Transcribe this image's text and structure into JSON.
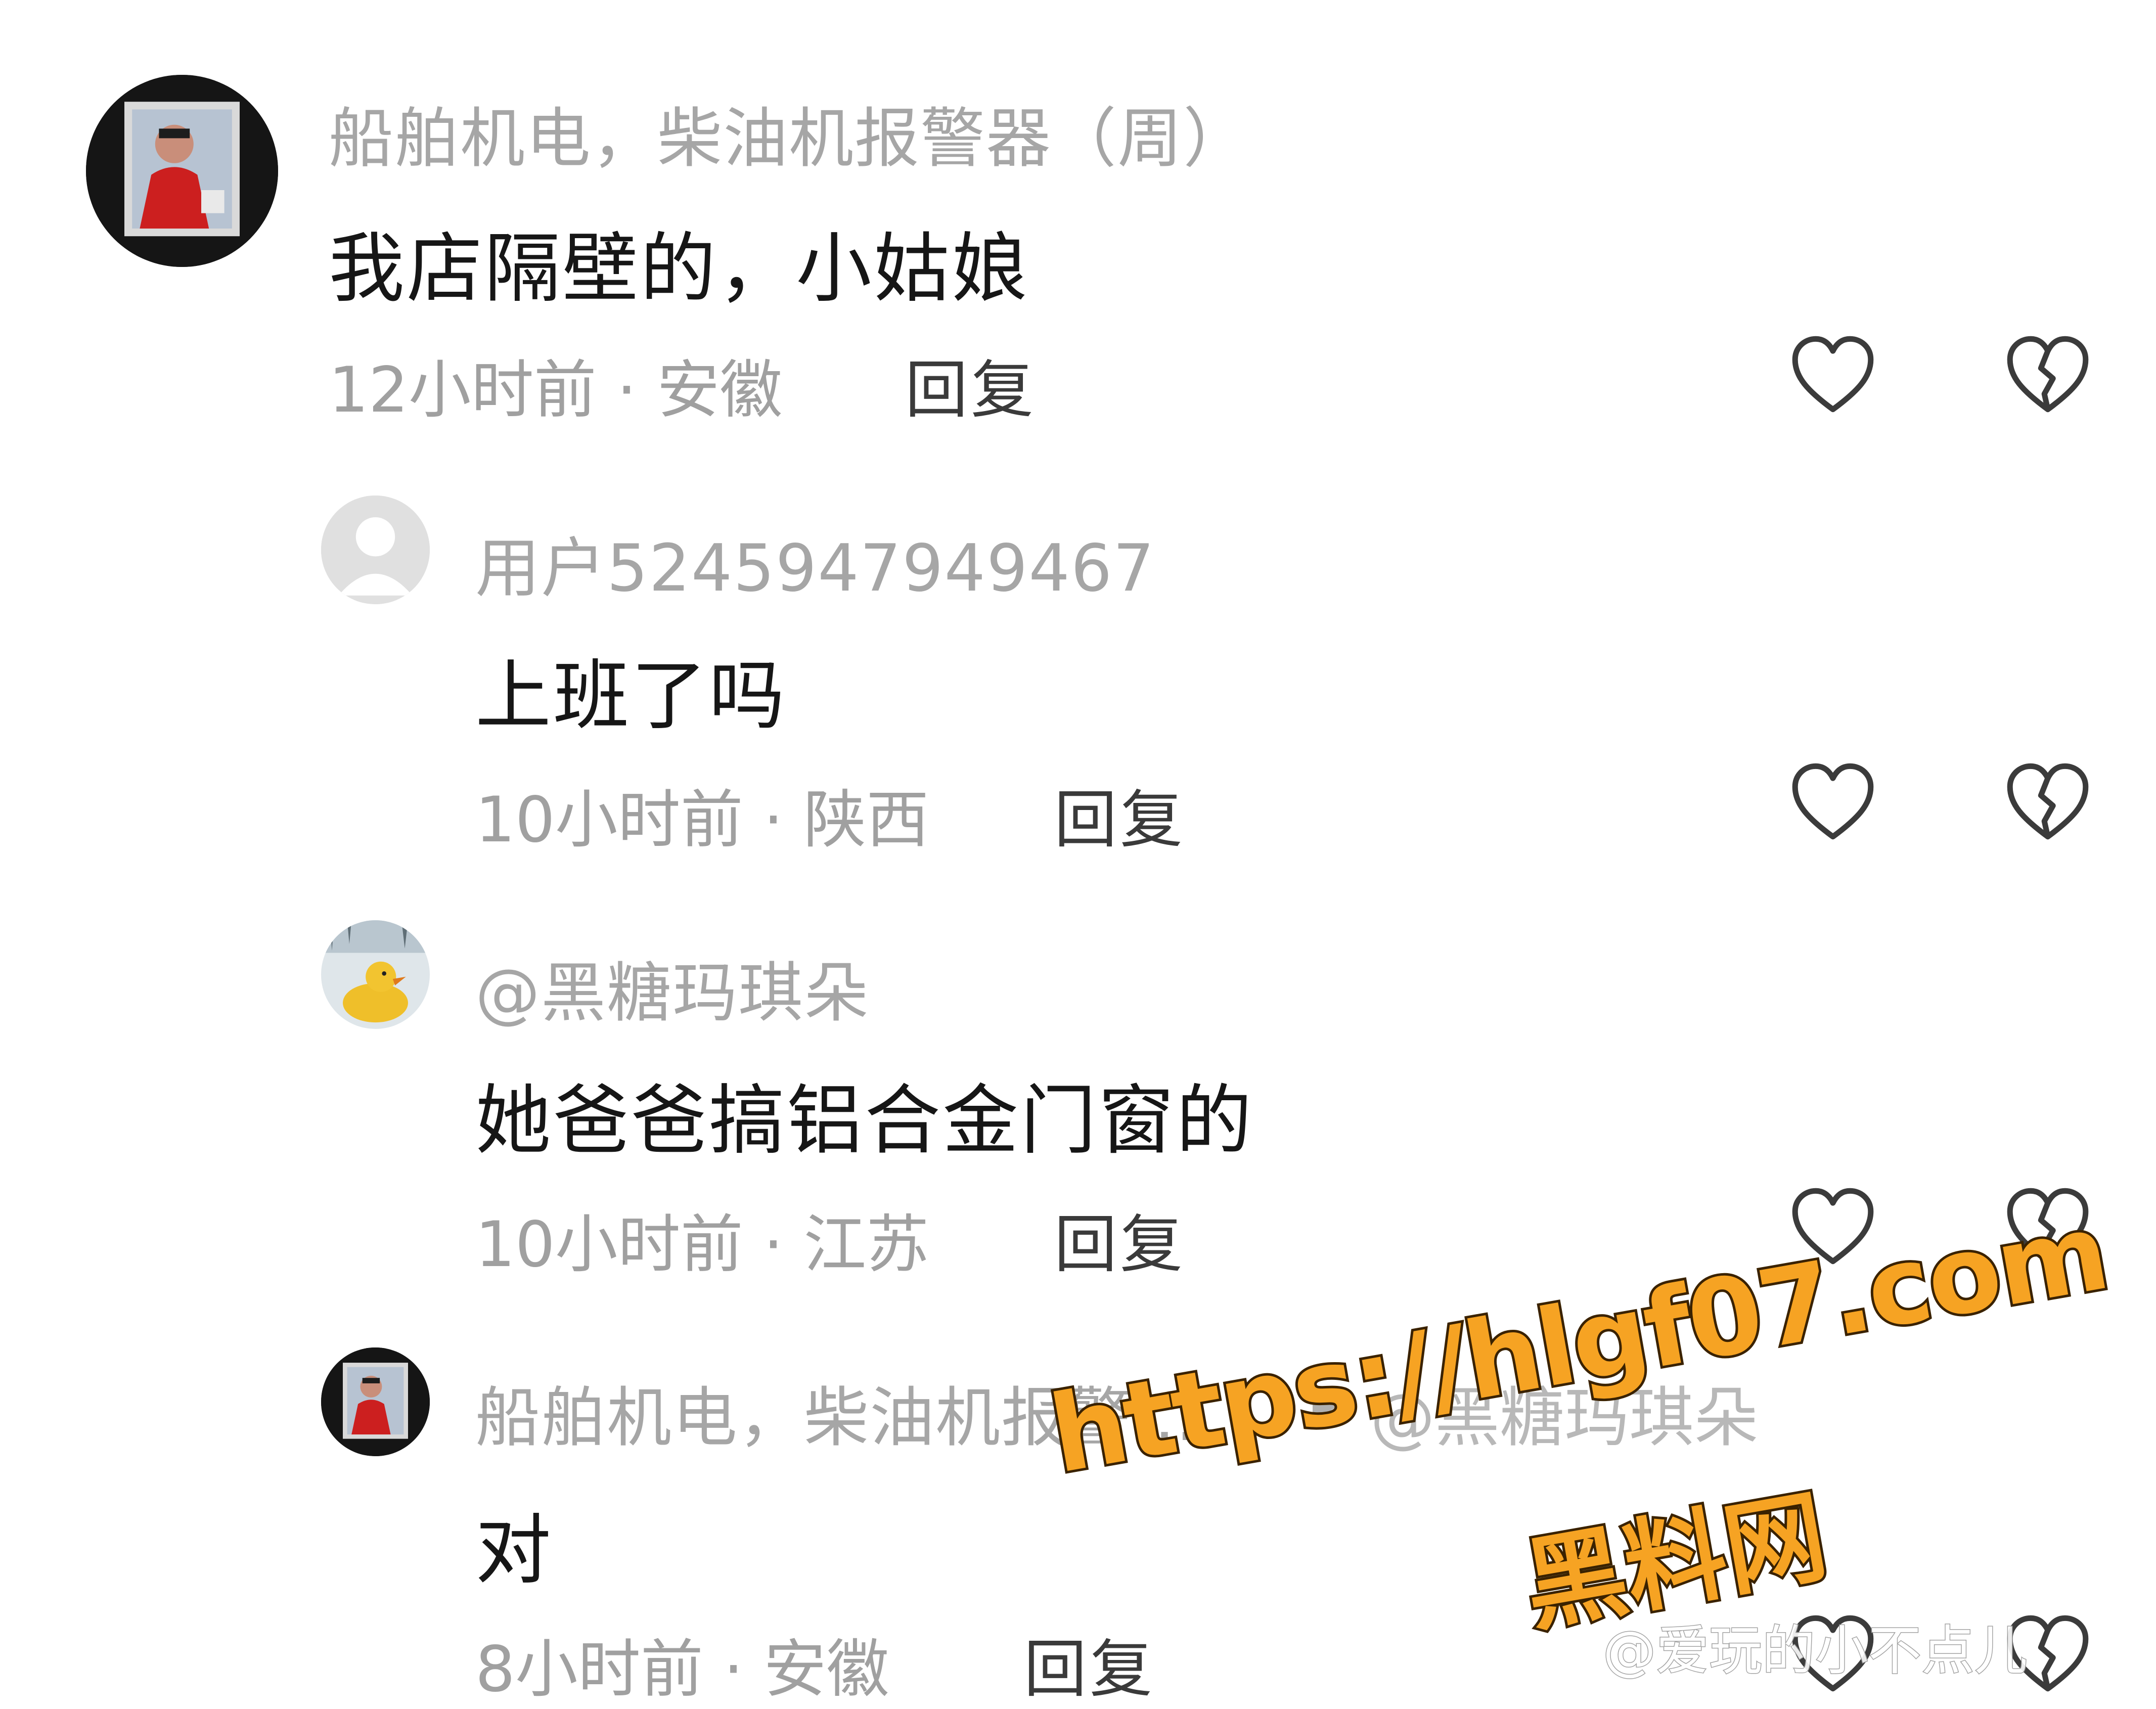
{
  "comments": [
    {
      "username": "船舶机电，柴油机报警器（周）",
      "text": "我店隔壁的，小姑娘",
      "time": "12小时前",
      "location": "安徽",
      "reply_label": "回复"
    },
    {
      "username": "用户5245947949467",
      "text": "上班了吗",
      "time": "10小时前",
      "location": "陕西",
      "reply_label": "回复"
    },
    {
      "username": "@黑糖玛琪朵",
      "text": "她爸爸搞铝合金门窗的",
      "time": "10小时前",
      "location": "江苏",
      "reply_label": "回复"
    },
    {
      "username": "船舶机电，柴油机报警...",
      "reply_to": "@黑糖玛琪朵",
      "text": "对",
      "time": "8小时前",
      "location": "安徽",
      "reply_label": "回复"
    }
  ],
  "separator": "·",
  "icons": {
    "like": "heart-outline-icon",
    "dislike": "broken-heart-outline-icon",
    "reply_arrow": "play-triangle-icon"
  },
  "watermark": {
    "url": "https://hlgf07.com",
    "site": "黑料网",
    "credit": "@爱玩的小不点儿"
  },
  "colors": {
    "username": "#a6a6a6",
    "text": "#161616",
    "meta": "#a0a0a0",
    "reply": "#3a3a3a",
    "watermark_fill": "#f6a323",
    "watermark_stroke": "#3a2200"
  }
}
